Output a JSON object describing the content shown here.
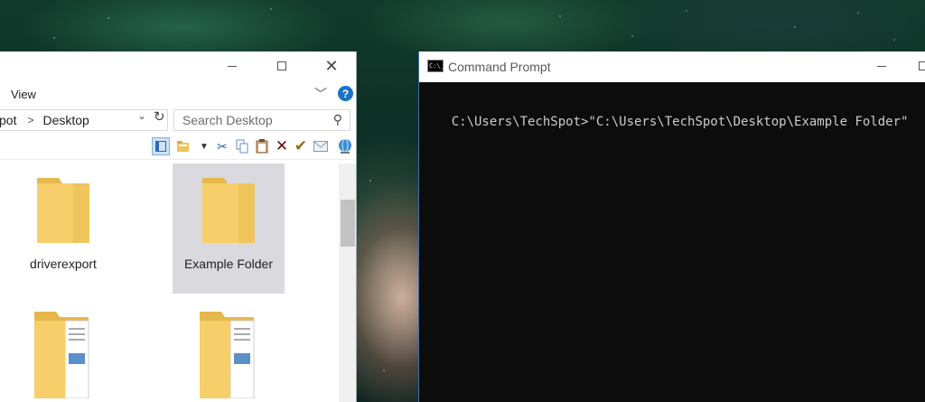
{
  "explorer": {
    "ribbon_tab": "View",
    "help": "?",
    "address": {
      "crumb_partial": "pot",
      "current": "Desktop"
    },
    "search_placeholder": "Search Desktop",
    "items": [
      {
        "name": "driverexport",
        "selected": false,
        "icon": "folder-icon"
      },
      {
        "name": "Example Folder",
        "selected": true,
        "icon": "folder-icon"
      },
      {
        "name": "",
        "selected": false,
        "icon": "folder-documents-icon"
      },
      {
        "name": "",
        "selected": false,
        "icon": "folder-documents-icon"
      }
    ]
  },
  "cmd": {
    "title": "Command Prompt",
    "icon_text": "C:\\_",
    "line": "C:\\Users\\TechSpot>\"C:\\Users\\TechSpot\\Desktop\\Example Folder\""
  },
  "colors": {
    "folder": "#f6cf6b",
    "folder_dark": "#e6b84c",
    "selection": "#d9d9de",
    "console_bg": "#0c0c0c",
    "console_text": "#cccccc"
  }
}
